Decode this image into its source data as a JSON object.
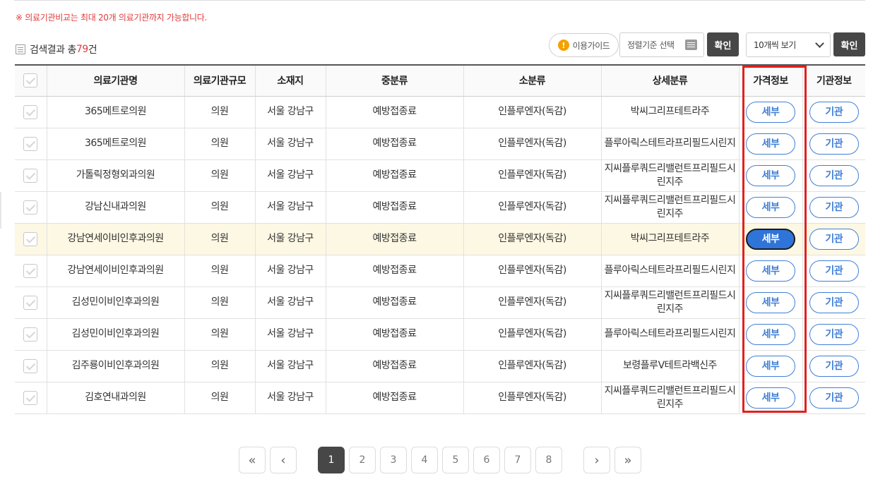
{
  "notice": "※ 의료기관비교는 최대 20개 의료기관까지 가능합니다.",
  "result": {
    "prefix": "검색결과 총",
    "count": "79",
    "suffix": "건"
  },
  "toolbar": {
    "guide_label": "이용가이드",
    "guide_icon": "!",
    "sort_label": "정렬기준 선택",
    "confirm_label": "확인",
    "perpage_label": "10개씩 보기",
    "confirm2_label": "확인"
  },
  "table": {
    "headers": [
      "의료기관명",
      "의료기관규모",
      "소재지",
      "중분류",
      "소분류",
      "상세분류",
      "가격정보",
      "기관정보"
    ],
    "rows": [
      {
        "name": "365메트로의원",
        "size": "의원",
        "location": "서울 강남구",
        "mid": "예방접종료",
        "sub": "인플루엔자(독감)",
        "detail": "박씨그리프테트라주",
        "price": "세부",
        "org": "기관"
      },
      {
        "name": "365메트로의원",
        "size": "의원",
        "location": "서울 강남구",
        "mid": "예방접종료",
        "sub": "인플루엔자(독감)",
        "detail": "플루아릭스테트라프리필드시린지",
        "price": "세부",
        "org": "기관"
      },
      {
        "name": "가톨릭정형외과의원",
        "size": "의원",
        "location": "서울 강남구",
        "mid": "예방접종료",
        "sub": "인플루엔자(독감)",
        "detail": "지씨플루쿼드리밸런트프리필드시린지주",
        "price": "세부",
        "org": "기관"
      },
      {
        "name": "강남신내과의원",
        "size": "의원",
        "location": "서울 강남구",
        "mid": "예방접종료",
        "sub": "인플루엔자(독감)",
        "detail": "지씨플루쿼드리밸런트프리필드시린지주",
        "price": "세부",
        "org": "기관"
      },
      {
        "name": "강남연세이비인후과의원",
        "size": "의원",
        "location": "서울 강남구",
        "mid": "예방접종료",
        "sub": "인플루엔자(독감)",
        "detail": "박씨그리프테트라주",
        "price": "세부",
        "org": "기관"
      },
      {
        "name": "강남연세이비인후과의원",
        "size": "의원",
        "location": "서울 강남구",
        "mid": "예방접종료",
        "sub": "인플루엔자(독감)",
        "detail": "플루아릭스테트라프리필드시린지",
        "price": "세부",
        "org": "기관"
      },
      {
        "name": "김성민이비인후과의원",
        "size": "의원",
        "location": "서울 강남구",
        "mid": "예방접종료",
        "sub": "인플루엔자(독감)",
        "detail": "지씨플루쿼드리밸런트프리필드시린지주",
        "price": "세부",
        "org": "기관"
      },
      {
        "name": "김성민이비인후과의원",
        "size": "의원",
        "location": "서울 강남구",
        "mid": "예방접종료",
        "sub": "인플루엔자(독감)",
        "detail": "플루아릭스테트라프리필드시린지",
        "price": "세부",
        "org": "기관"
      },
      {
        "name": "김주룡이비인후과의원",
        "size": "의원",
        "location": "서울 강남구",
        "mid": "예방접종료",
        "sub": "인플루엔자(독감)",
        "detail": "보령플루Ⅴ테트라백신주",
        "price": "세부",
        "org": "기관"
      },
      {
        "name": "김호연내과의원",
        "size": "의원",
        "location": "서울 강남구",
        "mid": "예방접종료",
        "sub": "인플루엔자(독감)",
        "detail": "지씨플루쿼드리밸런트프리필드시린지주",
        "price": "세부",
        "org": "기관"
      }
    ]
  },
  "pagination": {
    "first": "«",
    "prev": "‹",
    "pages": [
      "1",
      "2",
      "3",
      "4",
      "5",
      "6",
      "7",
      "8"
    ],
    "current": "1",
    "next": "›",
    "last": "»"
  },
  "colors": {
    "accent": "#2f74d8",
    "notice": "#e03b3b",
    "highlight_box": "#e02020",
    "dark_button": "#474747",
    "row_highlight": "#fdf8e4"
  }
}
